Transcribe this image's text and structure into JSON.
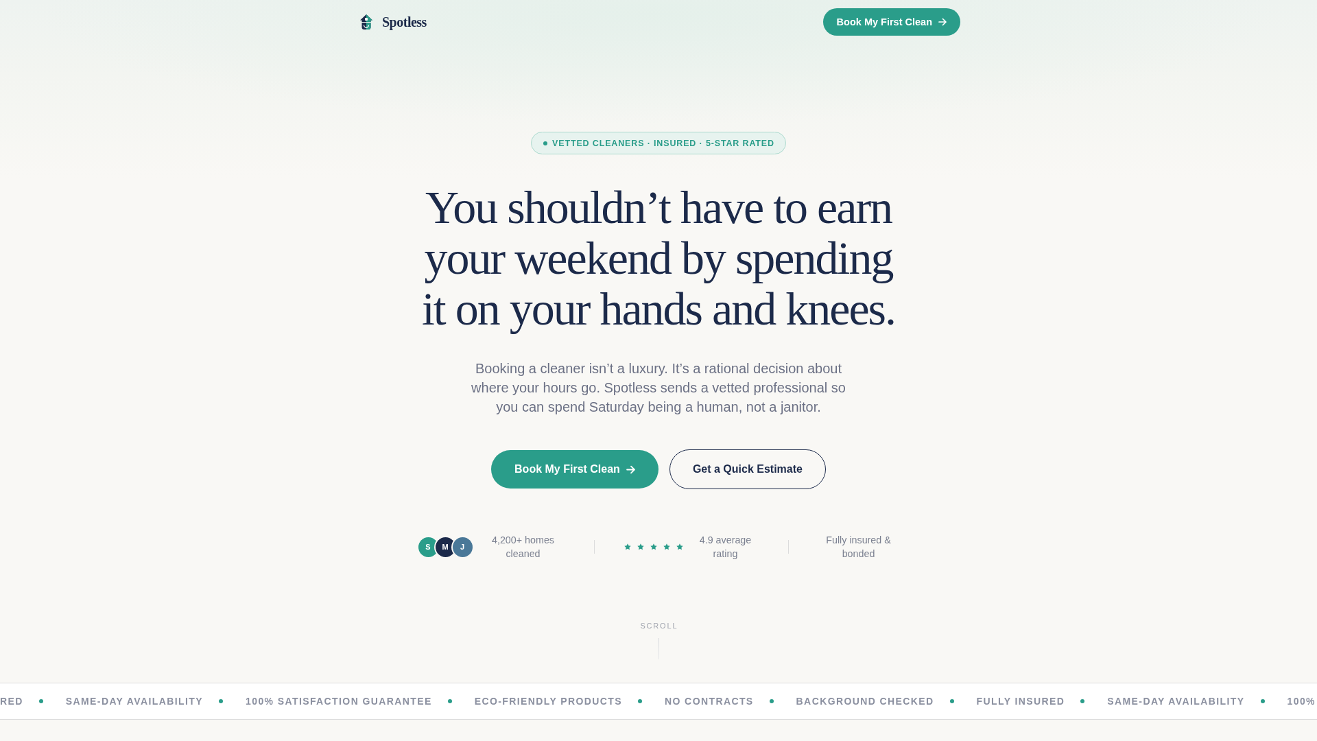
{
  "nav": {
    "brand": "Spotless",
    "cta": {
      "label": "Book My First Clean",
      "kind": "primary"
    }
  },
  "hero": {
    "badge": "VETTED CLEANERS · INSURED · 5-STAR RATED",
    "headline": "You shouldn’t have to earn your weekend by spending it on your hands and knees.",
    "subheadline": "Booking a cleaner isn’t a luxury. It’s a rational decision about where your hours go. Spotless sends a vetted professional so you can spend Saturday being a human, not a janitor.",
    "ctas": [
      {
        "label": "Book My First Clean",
        "kind": "primary"
      },
      {
        "label": "Get a Quick Estimate",
        "kind": "secondary"
      }
    ]
  },
  "stats": [
    {
      "kind": "avatars",
      "avatars": [
        {
          "initial": "S",
          "color": "#2a9d8a"
        },
        {
          "initial": "M",
          "color": "#1c2a4a"
        },
        {
          "initial": "J",
          "color": "#4a7898"
        }
      ],
      "label": "4,200+ homes cleaned"
    },
    {
      "kind": "rating",
      "stars": 5,
      "label": "4.9 average rating"
    },
    {
      "kind": "text",
      "label": "Fully insured & bonded"
    }
  ],
  "scroll_hint": "SCROLL",
  "ticker": [
    "RED",
    "SAME-DAY AVAILABILITY",
    "100% SATISFACTION GUARANTEE",
    "ECO-FRIENDLY PRODUCTS",
    "NO CONTRACTS",
    "BACKGROUND CHECKED",
    "FULLY INSURED",
    "SAME-DAY AVAILABILITY",
    "100%"
  ]
}
